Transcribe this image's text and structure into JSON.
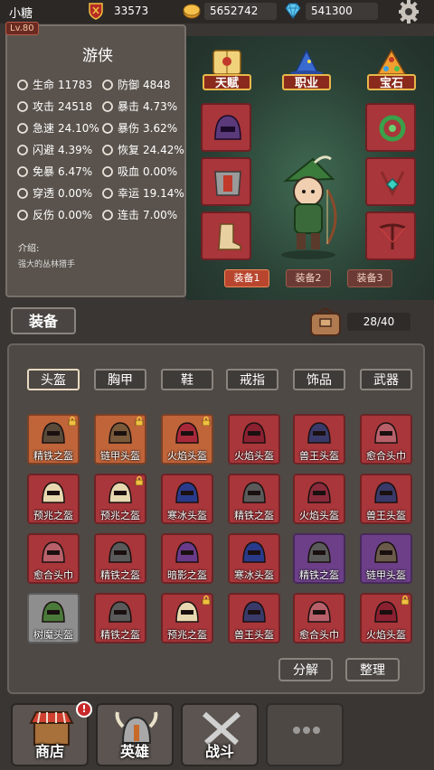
{
  "player": {
    "name": "小糖",
    "level": "Lv.80"
  },
  "resources": [
    {
      "icon": "attack-shield-icon",
      "value": "33573"
    },
    {
      "icon": "gold-coin-icon",
      "value": "5652742"
    },
    {
      "icon": "diamond-icon",
      "value": "541300"
    }
  ],
  "character": {
    "class_name": "游侠",
    "stats": [
      {
        "icon": "heart-icon",
        "label": "生命",
        "value": "11783"
      },
      {
        "icon": "shield-icon",
        "label": "防御",
        "value": "4848"
      },
      {
        "icon": "sword-icon",
        "label": "攻击",
        "value": "24518"
      },
      {
        "icon": "crit-icon",
        "label": "暴击",
        "value": "4.73%"
      },
      {
        "icon": "haste-icon",
        "label": "急速",
        "value": "24.10%"
      },
      {
        "icon": "crit-damage-icon",
        "label": "暴伤",
        "value": "3.62%"
      },
      {
        "icon": "dodge-icon",
        "label": "闪避",
        "value": "4.39%"
      },
      {
        "icon": "recover-icon",
        "label": "恢复",
        "value": "24.42%"
      },
      {
        "icon": "crit-resist-icon",
        "label": "免暴",
        "value": "6.47%"
      },
      {
        "icon": "lifesteal-icon",
        "label": "吸血",
        "value": "0.00%"
      },
      {
        "icon": "pierce-icon",
        "label": "穿透",
        "value": "0.00%"
      },
      {
        "icon": "luck-icon",
        "label": "幸运",
        "value": "19.14%"
      },
      {
        "icon": "reflect-icon",
        "label": "反伤",
        "value": "0.00%"
      },
      {
        "icon": "combo-icon",
        "label": "连击",
        "value": "7.00%"
      }
    ],
    "intro_label": "介绍:",
    "intro_text": "强大的丛林猎手"
  },
  "scene": {
    "buttons": {
      "talent": "天赋",
      "job": "职业",
      "gem": "宝石"
    },
    "set_tabs": [
      "装备1",
      "装备2",
      "装备3"
    ]
  },
  "equipment": {
    "title": "装备",
    "capacity": "28/40",
    "categories": [
      "头盔",
      "胸甲",
      "鞋",
      "戒指",
      "饰品",
      "武器"
    ],
    "items": [
      {
        "name": "精铁之盔",
        "rarity": "orange",
        "locked": true
      },
      {
        "name": "链甲头盔",
        "rarity": "orange",
        "locked": true
      },
      {
        "name": "火焰头盔",
        "rarity": "orange",
        "locked": true
      },
      {
        "name": "火焰头盔",
        "rarity": "red",
        "locked": false
      },
      {
        "name": "兽王头盔",
        "rarity": "red",
        "locked": false
      },
      {
        "name": "愈合头巾",
        "rarity": "red",
        "locked": false
      },
      {
        "name": "预兆之盔",
        "rarity": "red",
        "locked": false
      },
      {
        "name": "预兆之盔",
        "rarity": "red",
        "locked": true
      },
      {
        "name": "寒冰头盔",
        "rarity": "red",
        "locked": false
      },
      {
        "name": "精铁之盔",
        "rarity": "red",
        "locked": false
      },
      {
        "name": "火焰头盔",
        "rarity": "red",
        "locked": false
      },
      {
        "name": "兽王头盔",
        "rarity": "red",
        "locked": false
      },
      {
        "name": "愈合头巾",
        "rarity": "red",
        "locked": false
      },
      {
        "name": "精铁之盔",
        "rarity": "red",
        "locked": false
      },
      {
        "name": "暗影之盔",
        "rarity": "red",
        "locked": false
      },
      {
        "name": "寒冰头盔",
        "rarity": "red",
        "locked": false
      },
      {
        "name": "精铁之盔",
        "rarity": "purple",
        "locked": false
      },
      {
        "name": "链甲头盔",
        "rarity": "purple",
        "locked": false
      },
      {
        "name": "树魔头盔",
        "rarity": "gray",
        "locked": false
      },
      {
        "name": "精铁之盔",
        "rarity": "red",
        "locked": false
      },
      {
        "name": "预兆之盔",
        "rarity": "red",
        "locked": true
      },
      {
        "name": "兽王头盔",
        "rarity": "red",
        "locked": false
      },
      {
        "name": "愈合头巾",
        "rarity": "red",
        "locked": false
      },
      {
        "name": "火焰头盔",
        "rarity": "red",
        "locked": true
      }
    ],
    "actions": {
      "decompose": "分解",
      "sort": "整理"
    }
  },
  "nav": [
    {
      "label": "商店",
      "icon": "shop-icon",
      "badge": "!"
    },
    {
      "label": "英雄",
      "icon": "hero-helmet-icon",
      "badge": ""
    },
    {
      "label": "战斗",
      "icon": "crossed-swords-icon",
      "badge": ""
    },
    {
      "label": "",
      "icon": "more-icon",
      "badge": ""
    }
  ],
  "colors": {
    "rarity_orange": "#c0643a",
    "rarity_red": "#a8363a",
    "rarity_purple": "#6c3f88",
    "rarity_gray": "#8e8e8e"
  }
}
